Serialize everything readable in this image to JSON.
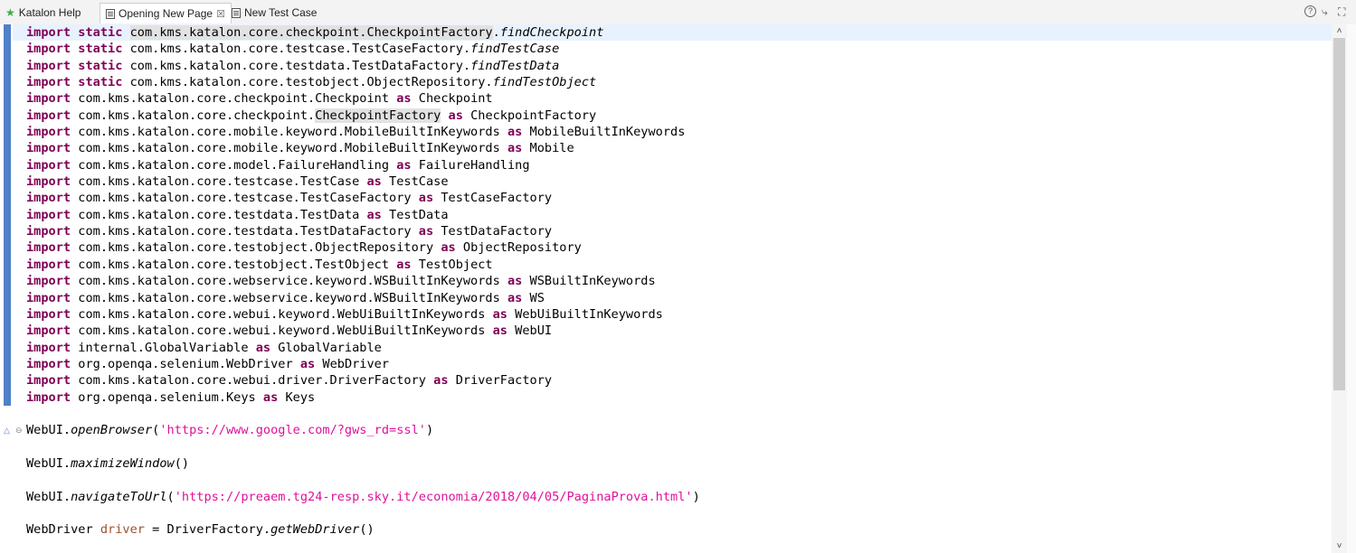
{
  "tabs": [
    {
      "label": "Katalon Help",
      "icon": "star-icon",
      "active": false
    },
    {
      "label": "Opening New Page",
      "icon": "test-case-icon",
      "active": true,
      "close": "☒"
    },
    {
      "label": "New Test Case",
      "icon": "test-case-icon",
      "active": false
    }
  ],
  "window_controls": {
    "help": "?",
    "minimize": "⤷",
    "maximize": "⛶"
  },
  "scrollbar": {
    "up": "˄",
    "down": "˅"
  },
  "code_lines": [
    {
      "tokens": [
        [
          "kw",
          "import"
        ],
        [
          "t",
          " "
        ],
        [
          "kw",
          "static"
        ],
        [
          "t",
          " "
        ],
        [
          "hl",
          "com.kms.katalon.core.checkpoint.CheckpointFactory"
        ],
        [
          "t",
          "."
        ],
        [
          "it",
          "findCheckpoint"
        ]
      ]
    },
    {
      "tokens": [
        [
          "kw",
          "import"
        ],
        [
          "t",
          " "
        ],
        [
          "kw",
          "static"
        ],
        [
          "t",
          " com.kms.katalon.core.testcase.TestCaseFactory."
        ],
        [
          "it",
          "findTestCase"
        ]
      ]
    },
    {
      "tokens": [
        [
          "kw",
          "import"
        ],
        [
          "t",
          " "
        ],
        [
          "kw",
          "static"
        ],
        [
          "t",
          " com.kms.katalon.core.testdata.TestDataFactory."
        ],
        [
          "it",
          "findTestData"
        ]
      ]
    },
    {
      "tokens": [
        [
          "kw",
          "import"
        ],
        [
          "t",
          " "
        ],
        [
          "kw",
          "static"
        ],
        [
          "t",
          " com.kms.katalon.core.testobject.ObjectRepository."
        ],
        [
          "it",
          "findTestObject"
        ]
      ]
    },
    {
      "tokens": [
        [
          "kw",
          "import"
        ],
        [
          "t",
          " com.kms.katalon.core.checkpoint.Checkpoint "
        ],
        [
          "kw",
          "as"
        ],
        [
          "t",
          " Checkpoint"
        ]
      ]
    },
    {
      "tokens": [
        [
          "kw",
          "import"
        ],
        [
          "t",
          " com.kms.katalon.core.checkpoint."
        ],
        [
          "hl",
          "CheckpointFactory"
        ],
        [
          "t",
          " "
        ],
        [
          "kw",
          "as"
        ],
        [
          "t",
          " CheckpointFactory"
        ]
      ]
    },
    {
      "tokens": [
        [
          "kw",
          "import"
        ],
        [
          "t",
          " com.kms.katalon.core.mobile.keyword.MobileBuiltInKeywords "
        ],
        [
          "kw",
          "as"
        ],
        [
          "t",
          " MobileBuiltInKeywords"
        ]
      ]
    },
    {
      "tokens": [
        [
          "kw",
          "import"
        ],
        [
          "t",
          " com.kms.katalon.core.mobile.keyword.MobileBuiltInKeywords "
        ],
        [
          "kw",
          "as"
        ],
        [
          "t",
          " Mobile"
        ]
      ]
    },
    {
      "tokens": [
        [
          "kw",
          "import"
        ],
        [
          "t",
          " com.kms.katalon.core.model.FailureHandling "
        ],
        [
          "kw",
          "as"
        ],
        [
          "t",
          " FailureHandling"
        ]
      ]
    },
    {
      "tokens": [
        [
          "kw",
          "import"
        ],
        [
          "t",
          " com.kms.katalon.core.testcase.TestCase "
        ],
        [
          "kw",
          "as"
        ],
        [
          "t",
          " TestCase"
        ]
      ]
    },
    {
      "tokens": [
        [
          "kw",
          "import"
        ],
        [
          "t",
          " com.kms.katalon.core.testcase.TestCaseFactory "
        ],
        [
          "kw",
          "as"
        ],
        [
          "t",
          " TestCaseFactory"
        ]
      ]
    },
    {
      "tokens": [
        [
          "kw",
          "import"
        ],
        [
          "t",
          " com.kms.katalon.core.testdata.TestData "
        ],
        [
          "kw",
          "as"
        ],
        [
          "t",
          " TestData"
        ]
      ]
    },
    {
      "tokens": [
        [
          "kw",
          "import"
        ],
        [
          "t",
          " com.kms.katalon.core.testdata.TestDataFactory "
        ],
        [
          "kw",
          "as"
        ],
        [
          "t",
          " TestDataFactory"
        ]
      ]
    },
    {
      "tokens": [
        [
          "kw",
          "import"
        ],
        [
          "t",
          " com.kms.katalon.core.testobject.ObjectRepository "
        ],
        [
          "kw",
          "as"
        ],
        [
          "t",
          " ObjectRepository"
        ]
      ]
    },
    {
      "tokens": [
        [
          "kw",
          "import"
        ],
        [
          "t",
          " com.kms.katalon.core.testobject.TestObject "
        ],
        [
          "kw",
          "as"
        ],
        [
          "t",
          " TestObject"
        ]
      ]
    },
    {
      "tokens": [
        [
          "kw",
          "import"
        ],
        [
          "t",
          " com.kms.katalon.core.webservice.keyword.WSBuiltInKeywords "
        ],
        [
          "kw",
          "as"
        ],
        [
          "t",
          " WSBuiltInKeywords"
        ]
      ]
    },
    {
      "tokens": [
        [
          "kw",
          "import"
        ],
        [
          "t",
          " com.kms.katalon.core.webservice.keyword.WSBuiltInKeywords "
        ],
        [
          "kw",
          "as"
        ],
        [
          "t",
          " WS"
        ]
      ]
    },
    {
      "tokens": [
        [
          "kw",
          "import"
        ],
        [
          "t",
          " com.kms.katalon.core.webui.keyword.WebUiBuiltInKeywords "
        ],
        [
          "kw",
          "as"
        ],
        [
          "t",
          " WebUiBuiltInKeywords"
        ]
      ]
    },
    {
      "tokens": [
        [
          "kw",
          "import"
        ],
        [
          "t",
          " com.kms.katalon.core.webui.keyword.WebUiBuiltInKeywords "
        ],
        [
          "kw",
          "as"
        ],
        [
          "t",
          " WebUI"
        ]
      ]
    },
    {
      "tokens": [
        [
          "kw",
          "import"
        ],
        [
          "t",
          " internal.GlobalVariable "
        ],
        [
          "kw",
          "as"
        ],
        [
          "t",
          " GlobalVariable"
        ]
      ]
    },
    {
      "tokens": [
        [
          "kw",
          "import"
        ],
        [
          "t",
          " org.openqa.selenium.WebDriver "
        ],
        [
          "kw",
          "as"
        ],
        [
          "t",
          " WebDriver"
        ]
      ]
    },
    {
      "tokens": [
        [
          "kw",
          "import"
        ],
        [
          "t",
          " com.kms.katalon.core.webui.driver.DriverFactory "
        ],
        [
          "kw",
          "as"
        ],
        [
          "t",
          " DriverFactory"
        ]
      ]
    },
    {
      "tokens": [
        [
          "kw",
          "import"
        ],
        [
          "t",
          " org.openqa.selenium.Keys "
        ],
        [
          "kw",
          "as"
        ],
        [
          "t",
          " Keys"
        ]
      ]
    },
    {
      "tokens": []
    },
    {
      "tokens": [
        [
          "t",
          "WebUI."
        ],
        [
          "it",
          "openBrowser"
        ],
        [
          "t",
          "("
        ],
        [
          "str",
          "'https://www.google.com/?gws_rd=ssl'"
        ],
        [
          "t",
          ")"
        ]
      ]
    },
    {
      "tokens": []
    },
    {
      "tokens": [
        [
          "t",
          "WebUI."
        ],
        [
          "it",
          "maximizeWindow"
        ],
        [
          "t",
          "()"
        ]
      ]
    },
    {
      "tokens": []
    },
    {
      "tokens": [
        [
          "t",
          "WebUI."
        ],
        [
          "it",
          "navigateToUrl"
        ],
        [
          "t",
          "("
        ],
        [
          "str",
          "'https://preaem.tg24-resp.sky.it/economia/2018/04/05/PaginaProva.html'"
        ],
        [
          "t",
          ")"
        ]
      ]
    },
    {
      "tokens": []
    },
    {
      "tokens": [
        [
          "t",
          "WebDriver "
        ],
        [
          "var",
          "driver"
        ],
        [
          "t",
          " = DriverFactory."
        ],
        [
          "it",
          "getWebDriver"
        ],
        [
          "t",
          "()"
        ]
      ]
    }
  ],
  "colors": {
    "keyword": "#7f0055",
    "string": "#e0119b",
    "variable": "#a0522d",
    "change_bar": "#4f80c8"
  }
}
